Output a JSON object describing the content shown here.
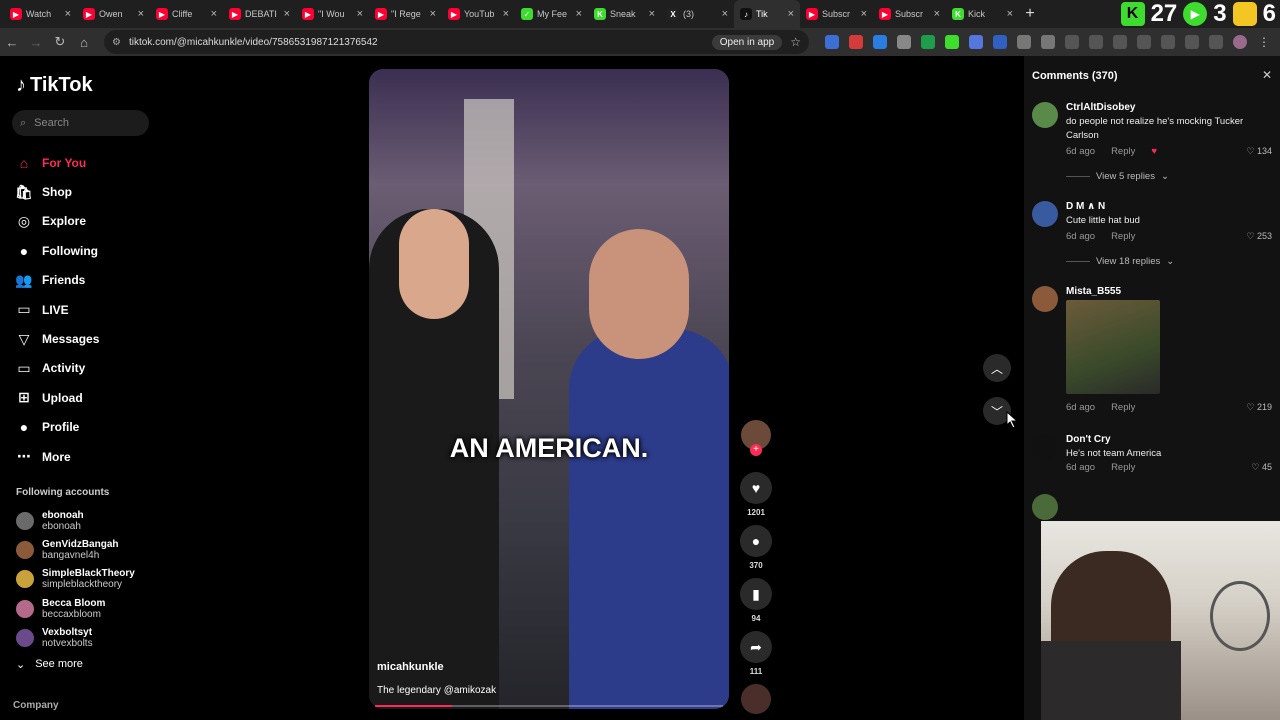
{
  "browser": {
    "tabs": [
      {
        "label": "Watch",
        "color": "#ff0033",
        "fav": "▶"
      },
      {
        "label": "Owen",
        "color": "#ff0033",
        "fav": "▶"
      },
      {
        "label": "Cliffe",
        "color": "#ff0033",
        "fav": "▶"
      },
      {
        "label": "DEBATI",
        "color": "#ff0033",
        "fav": "▶"
      },
      {
        "label": "\"I Wou",
        "color": "#ff0033",
        "fav": "▶"
      },
      {
        "label": "\"I Rege",
        "color": "#ff0033",
        "fav": "▶"
      },
      {
        "label": "YouTub",
        "color": "#ff0033",
        "fav": "▶"
      },
      {
        "label": "My Fee",
        "color": "#3ddc2e",
        "fav": "✓"
      },
      {
        "label": "Sneak",
        "color": "#3ddc2e",
        "fav": "K"
      },
      {
        "label": "(3)",
        "color": "#222222",
        "fav": "X"
      },
      {
        "label": "Tik",
        "color": "#111111",
        "fav": "♪",
        "active": true
      },
      {
        "label": "Subscr",
        "color": "#ff0033",
        "fav": "▶"
      },
      {
        "label": "Subscr",
        "color": "#ff0033",
        "fav": "▶"
      },
      {
        "label": "Kick",
        "color": "#3ddc2e",
        "fav": "K"
      }
    ],
    "tray_numbers": [
      "27",
      "3",
      "6"
    ],
    "url": "tiktok.com/@micahkunkle/video/7586531987121376542",
    "open_in_app": "Open in app"
  },
  "sidebar": {
    "logo": "TikTok",
    "search_placeholder": "Search",
    "items": [
      {
        "label": "For You",
        "icon": "⌂",
        "active": true
      },
      {
        "label": "Shop",
        "icon": "🛍"
      },
      {
        "label": "Explore",
        "icon": "◎"
      },
      {
        "label": "Following",
        "icon": "●"
      },
      {
        "label": "Friends",
        "icon": "👥"
      },
      {
        "label": "LIVE",
        "icon": "▭"
      },
      {
        "label": "Messages",
        "icon": "▽"
      },
      {
        "label": "Activity",
        "icon": "▭"
      },
      {
        "label": "Upload",
        "icon": "⊞"
      },
      {
        "label": "Profile",
        "icon": "●"
      },
      {
        "label": "More",
        "icon": "⋯"
      }
    ],
    "following_header": "Following accounts",
    "following": [
      {
        "name": "ebonoah",
        "handle": "ebonoah"
      },
      {
        "name": "GenVidzBangah",
        "handle": "bangavnel4h"
      },
      {
        "name": "SimpleBlackTheory",
        "handle": "simpleblacktheory"
      },
      {
        "name": "Becca Bloom",
        "handle": "beccaxbloom"
      },
      {
        "name": "Vexboltsyt",
        "handle": "notvexbolts"
      }
    ],
    "see_more": "See more",
    "company": "Company"
  },
  "video": {
    "caption": "AN AMERICAN.",
    "author": "micahkunkle",
    "description": "The legendary @amikozak",
    "progress": 0.22
  },
  "actions": {
    "likes": "1201",
    "comments": "370",
    "saves": "94",
    "shares": "111"
  },
  "comments": {
    "header": "Comments (370)",
    "items": [
      {
        "user": "CtrlAltDisobey",
        "text": "do people not realize he's mocking Tucker Carlson",
        "time": "6d ago",
        "reply": "Reply",
        "likes": "134",
        "replies": "View 5 replies"
      },
      {
        "user": "D M ∧ N",
        "text": "Cute little hat bud",
        "time": "6d ago",
        "reply": "Reply",
        "likes": "253",
        "replies": "View 18 replies"
      },
      {
        "user": "Mista_B555",
        "text": "",
        "time": "6d ago",
        "reply": "Reply",
        "likes": "219"
      },
      {
        "user": "Don't Cry",
        "text": "He's not team America",
        "time": "6d ago",
        "reply": "Reply",
        "likes": "45"
      }
    ]
  }
}
